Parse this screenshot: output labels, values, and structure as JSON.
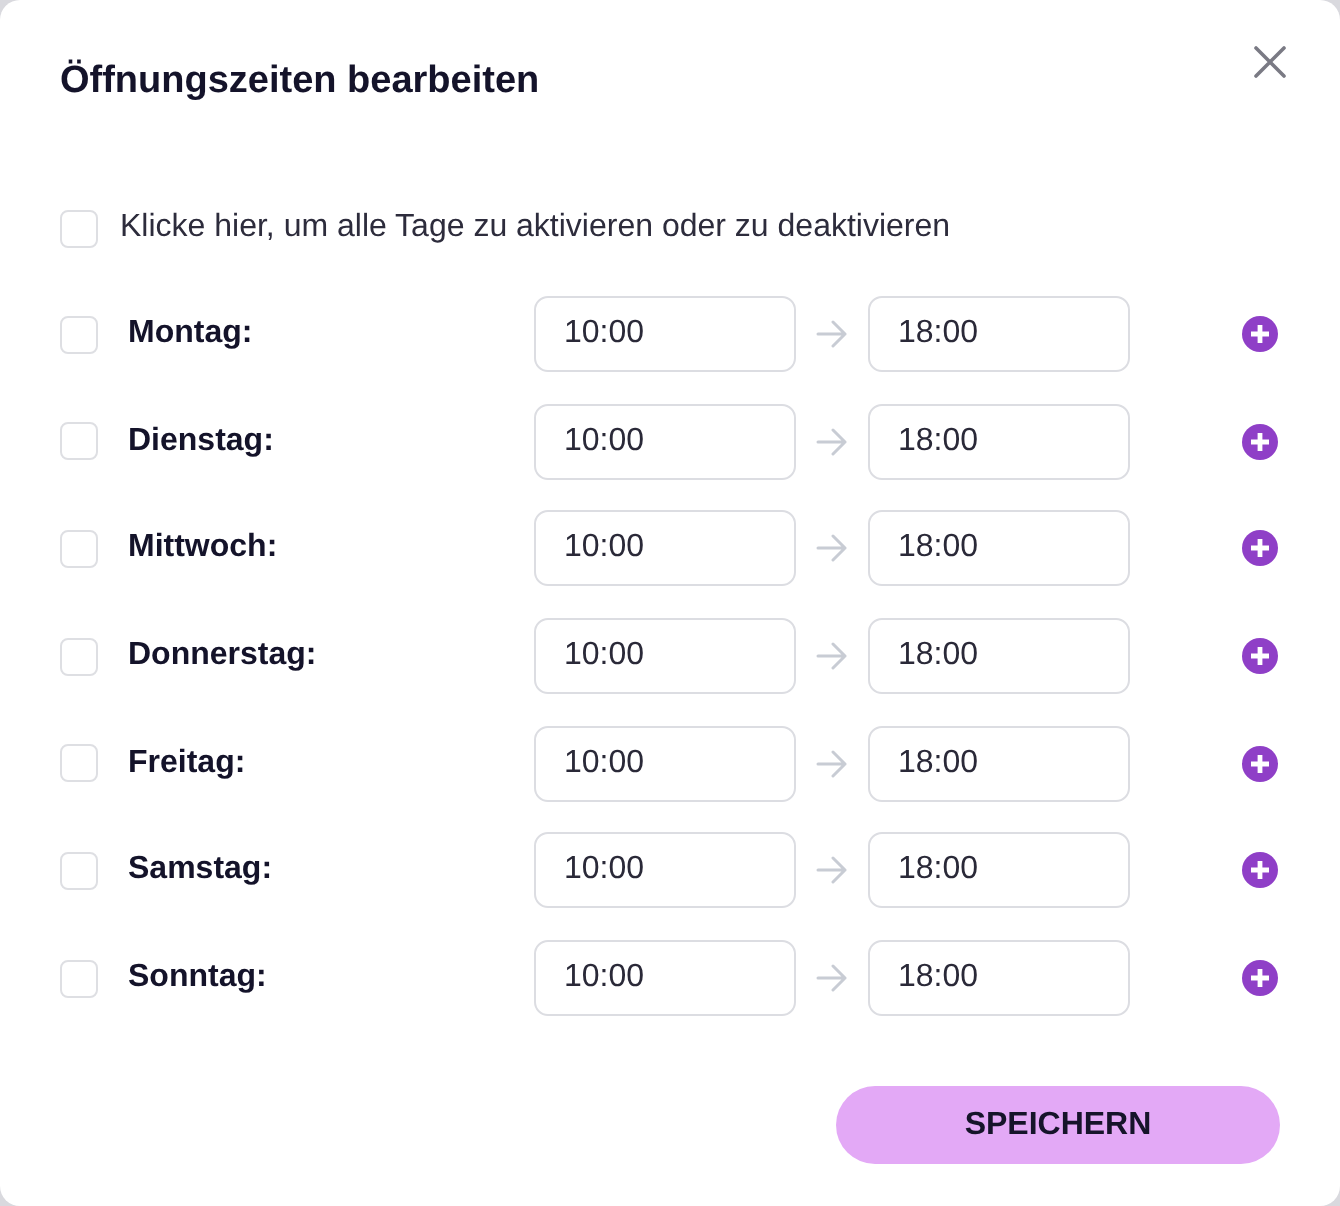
{
  "dialog": {
    "title": "Öffnungszeiten bearbeiten",
    "select_all": {
      "label": "Klicke hier, um alle Tage zu aktivieren oder zu deaktivieren",
      "checked": false
    },
    "days": [
      {
        "name": "Montag:",
        "checked": false,
        "from": "10:00",
        "to": "18:00"
      },
      {
        "name": "Dienstag:",
        "checked": false,
        "from": "10:00",
        "to": "18:00"
      },
      {
        "name": "Mittwoch:",
        "checked": false,
        "from": "10:00",
        "to": "18:00"
      },
      {
        "name": "Donnerstag:",
        "checked": false,
        "from": "10:00",
        "to": "18:00"
      },
      {
        "name": "Freitag:",
        "checked": false,
        "from": "10:00",
        "to": "18:00"
      },
      {
        "name": "Samstag:",
        "checked": false,
        "from": "10:00",
        "to": "18:00"
      },
      {
        "name": "Sonntag:",
        "checked": false,
        "from": "10:00",
        "to": "18:00"
      }
    ],
    "save_button": "SPEICHERN"
  }
}
